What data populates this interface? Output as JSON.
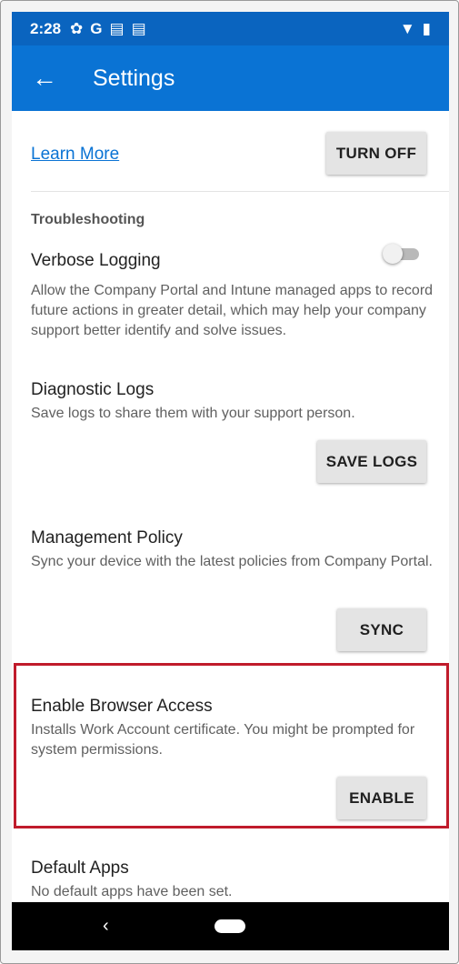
{
  "status_bar": {
    "time": "2:28",
    "icons": [
      "gear-icon",
      "google-icon",
      "calendar-icon",
      "calendar-icon",
      "wifi-icon",
      "battery-icon"
    ],
    "glyphs": {
      "gear": "✿",
      "google": "G",
      "cal": "▤",
      "wifi": "▼",
      "battery": "▮"
    }
  },
  "app_bar": {
    "back_glyph": "←",
    "title": "Settings"
  },
  "top": {
    "learn_more": "Learn More",
    "turn_off": "TURN OFF"
  },
  "troubleshooting": {
    "header": "Troubleshooting",
    "verbose": {
      "title": "Verbose Logging",
      "description": "Allow the Company Portal and Intune managed apps to record future actions in greater detail, which may help your company support better identify and solve issues.",
      "enabled": false
    },
    "diagnostic": {
      "title": "Diagnostic Logs",
      "description": "Save logs to share them with your support person.",
      "button": "SAVE LOGS"
    },
    "management": {
      "title": "Management Policy",
      "description": "Sync your device with the latest policies from Company Portal.",
      "button": "SYNC"
    },
    "browser": {
      "title": "Enable Browser Access",
      "description": "Installs Work Account certificate. You might be prompted for system permissions.",
      "button": "ENABLE"
    },
    "default_apps": {
      "title": "Default Apps",
      "description": "No default apps have been set."
    }
  },
  "nav_bar": {
    "back_glyph": "‹"
  },
  "colors": {
    "status_bar": "#0a64bf",
    "app_bar": "#0a73d4",
    "link": "#0a73d4",
    "highlight": "#c01b2b"
  }
}
